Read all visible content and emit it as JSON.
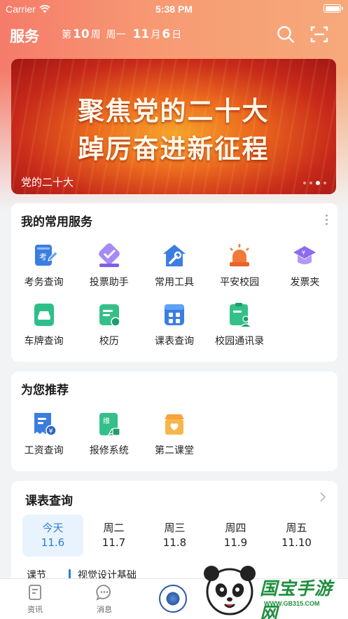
{
  "status_bar": {
    "carrier": "Carrier",
    "time": "5:38 PM"
  },
  "header": {
    "title": "服务",
    "week_prefix": "第",
    "week_number": "10",
    "week_suffix": "周",
    "weekday": "周一",
    "month": "11",
    "month_suffix": "月",
    "day": "6",
    "day_suffix": "日"
  },
  "banner": {
    "line1": "聚焦党的二十大",
    "line2": "踔厉奋进新征程",
    "caption": "党的二十大",
    "page_count": 4,
    "active_page": 2
  },
  "common_services": {
    "title": "我的常用服务",
    "items": [
      {
        "label": "考务查询",
        "icon": "exam-icon"
      },
      {
        "label": "投票助手",
        "icon": "vote-icon"
      },
      {
        "label": "常用工具",
        "icon": "tools-icon"
      },
      {
        "label": "平安校园",
        "icon": "alarm-icon"
      },
      {
        "label": "发票夹",
        "icon": "invoice-icon"
      },
      {
        "label": "车牌查询",
        "icon": "car-plate-icon"
      },
      {
        "label": "校历",
        "icon": "calendar-icon"
      },
      {
        "label": "课表查询",
        "icon": "timetable-icon"
      },
      {
        "label": "校园通讯录",
        "icon": "contacts-icon"
      }
    ]
  },
  "recommended": {
    "title": "为您推荐",
    "items": [
      {
        "label": "工资查询",
        "icon": "salary-icon",
        "glyph": "¥"
      },
      {
        "label": "报修系统",
        "icon": "repair-icon",
        "glyph": "维"
      },
      {
        "label": "第二课堂",
        "icon": "second-class-icon"
      }
    ]
  },
  "timetable": {
    "title": "课表查询",
    "days": [
      {
        "name": "今天",
        "date": "11.6",
        "active": true
      },
      {
        "name": "周二",
        "date": "11.7",
        "active": false
      },
      {
        "name": "周三",
        "date": "11.8",
        "active": false
      },
      {
        "name": "周四",
        "date": "11.9",
        "active": false
      },
      {
        "name": "周五",
        "date": "11.10",
        "active": false
      }
    ],
    "course_section_label": "课节",
    "course_name": "视觉设计基础"
  },
  "tabbar": {
    "tabs": [
      {
        "label": "资讯",
        "icon": "news-icon"
      },
      {
        "label": "消息",
        "icon": "message-icon"
      }
    ]
  },
  "watermark": {
    "text": "国宝手游网",
    "url": "WWW.GB315.COM"
  },
  "colors": {
    "accent": "#2a7fd6",
    "header_gradient_start": "#f57b6a",
    "header_gradient_end": "#f6a97a"
  }
}
